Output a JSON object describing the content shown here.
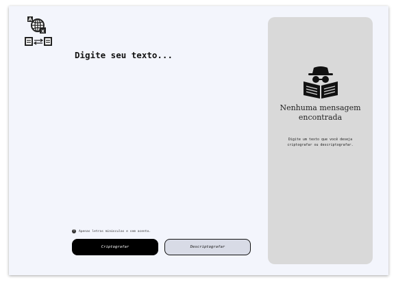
{
  "editor": {
    "placeholder": "Digite seu texto..."
  },
  "hint": {
    "icon": "info-icon",
    "text": "Apenas letras minúsculas e sem acento."
  },
  "actions": {
    "encrypt_label": "Criptografar",
    "decrypt_label": "Descriptografar"
  },
  "output_panel": {
    "illustration": "incognito-reader-icon",
    "title": "Nenhuma mensagem encontrada",
    "description": "Digite um texto que você deseja criptografar ou descriptografar."
  },
  "logo": {
    "icon": "translate-globe-icon"
  },
  "colors": {
    "background": "#f3f5fc",
    "panel": "#d9d9d9",
    "primary_button": "#000000",
    "secondary_button": "#d8dbe6"
  }
}
